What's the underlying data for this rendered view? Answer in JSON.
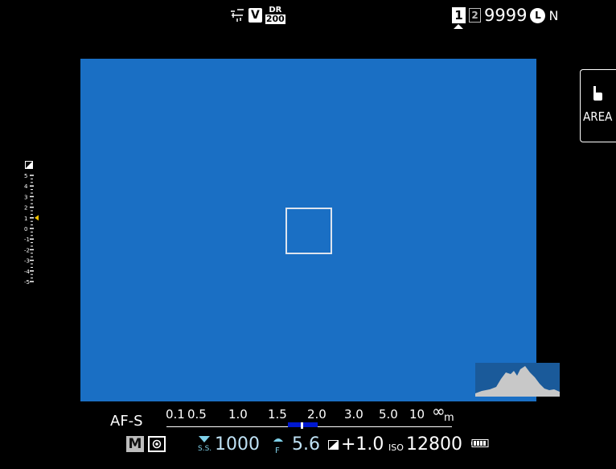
{
  "top": {
    "film_sim": "V",
    "dr_label": "DR",
    "dr_value": "200",
    "slot1": "1",
    "slot2": "2",
    "frames_remaining": "9999",
    "image_size": "L",
    "image_quality": "N"
  },
  "side": {
    "area_label": "AREA"
  },
  "exposure_scale": {
    "ticks": [
      "5",
      "4",
      "3",
      "2",
      "1",
      "0",
      "-1",
      "-2",
      "-3",
      "-4",
      "-5"
    ],
    "indicator_value": 1
  },
  "bottom": {
    "af_mode": "AF-S",
    "distance_labels": [
      "0.1",
      "0.5",
      "1.0",
      "1.5",
      "2.0",
      "3.0",
      "5.0",
      "10",
      "∞",
      "m"
    ],
    "shooting_mode": "M",
    "ss_prefix": "S.S.",
    "shutter_speed": "1000",
    "aperture_prefix": "F",
    "aperture": "5.6",
    "exposure_comp": "+1.0",
    "iso_label": "ISO",
    "iso": "12800"
  },
  "colors": {
    "liveview": "#1a6fc4",
    "dof_bar": "#0018d0",
    "exposure_indicator": "#f5c400",
    "value_tint": "#bfe2f5"
  }
}
